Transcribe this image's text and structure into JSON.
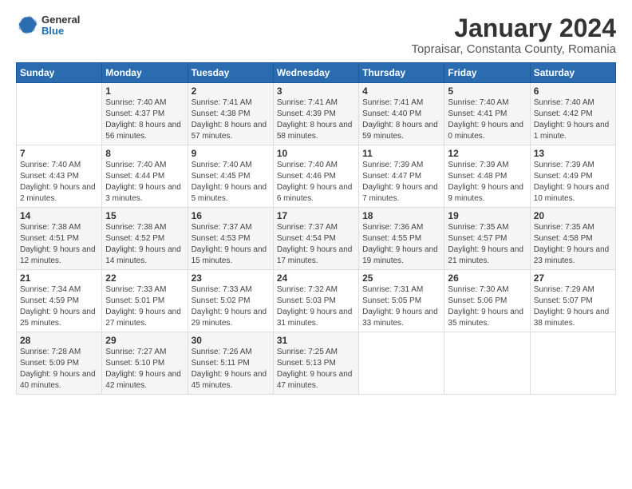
{
  "header": {
    "logo_general": "General",
    "logo_blue": "Blue",
    "title": "January 2024",
    "subtitle": "Topraisar, Constanta County, Romania"
  },
  "days_of_week": [
    "Sunday",
    "Monday",
    "Tuesday",
    "Wednesday",
    "Thursday",
    "Friday",
    "Saturday"
  ],
  "weeks": [
    [
      {
        "day": "",
        "sunrise": "",
        "sunset": "",
        "daylight": ""
      },
      {
        "day": "1",
        "sunrise": "Sunrise: 7:40 AM",
        "sunset": "Sunset: 4:37 PM",
        "daylight": "Daylight: 8 hours and 56 minutes."
      },
      {
        "day": "2",
        "sunrise": "Sunrise: 7:41 AM",
        "sunset": "Sunset: 4:38 PM",
        "daylight": "Daylight: 8 hours and 57 minutes."
      },
      {
        "day": "3",
        "sunrise": "Sunrise: 7:41 AM",
        "sunset": "Sunset: 4:39 PM",
        "daylight": "Daylight: 8 hours and 58 minutes."
      },
      {
        "day": "4",
        "sunrise": "Sunrise: 7:41 AM",
        "sunset": "Sunset: 4:40 PM",
        "daylight": "Daylight: 8 hours and 59 minutes."
      },
      {
        "day": "5",
        "sunrise": "Sunrise: 7:40 AM",
        "sunset": "Sunset: 4:41 PM",
        "daylight": "Daylight: 9 hours and 0 minutes."
      },
      {
        "day": "6",
        "sunrise": "Sunrise: 7:40 AM",
        "sunset": "Sunset: 4:42 PM",
        "daylight": "Daylight: 9 hours and 1 minute."
      }
    ],
    [
      {
        "day": "7",
        "sunrise": "Sunrise: 7:40 AM",
        "sunset": "Sunset: 4:43 PM",
        "daylight": "Daylight: 9 hours and 2 minutes."
      },
      {
        "day": "8",
        "sunrise": "Sunrise: 7:40 AM",
        "sunset": "Sunset: 4:44 PM",
        "daylight": "Daylight: 9 hours and 3 minutes."
      },
      {
        "day": "9",
        "sunrise": "Sunrise: 7:40 AM",
        "sunset": "Sunset: 4:45 PM",
        "daylight": "Daylight: 9 hours and 5 minutes."
      },
      {
        "day": "10",
        "sunrise": "Sunrise: 7:40 AM",
        "sunset": "Sunset: 4:46 PM",
        "daylight": "Daylight: 9 hours and 6 minutes."
      },
      {
        "day": "11",
        "sunrise": "Sunrise: 7:39 AM",
        "sunset": "Sunset: 4:47 PM",
        "daylight": "Daylight: 9 hours and 7 minutes."
      },
      {
        "day": "12",
        "sunrise": "Sunrise: 7:39 AM",
        "sunset": "Sunset: 4:48 PM",
        "daylight": "Daylight: 9 hours and 9 minutes."
      },
      {
        "day": "13",
        "sunrise": "Sunrise: 7:39 AM",
        "sunset": "Sunset: 4:49 PM",
        "daylight": "Daylight: 9 hours and 10 minutes."
      }
    ],
    [
      {
        "day": "14",
        "sunrise": "Sunrise: 7:38 AM",
        "sunset": "Sunset: 4:51 PM",
        "daylight": "Daylight: 9 hours and 12 minutes."
      },
      {
        "day": "15",
        "sunrise": "Sunrise: 7:38 AM",
        "sunset": "Sunset: 4:52 PM",
        "daylight": "Daylight: 9 hours and 14 minutes."
      },
      {
        "day": "16",
        "sunrise": "Sunrise: 7:37 AM",
        "sunset": "Sunset: 4:53 PM",
        "daylight": "Daylight: 9 hours and 15 minutes."
      },
      {
        "day": "17",
        "sunrise": "Sunrise: 7:37 AM",
        "sunset": "Sunset: 4:54 PM",
        "daylight": "Daylight: 9 hours and 17 minutes."
      },
      {
        "day": "18",
        "sunrise": "Sunrise: 7:36 AM",
        "sunset": "Sunset: 4:55 PM",
        "daylight": "Daylight: 9 hours and 19 minutes."
      },
      {
        "day": "19",
        "sunrise": "Sunrise: 7:35 AM",
        "sunset": "Sunset: 4:57 PM",
        "daylight": "Daylight: 9 hours and 21 minutes."
      },
      {
        "day": "20",
        "sunrise": "Sunrise: 7:35 AM",
        "sunset": "Sunset: 4:58 PM",
        "daylight": "Daylight: 9 hours and 23 minutes."
      }
    ],
    [
      {
        "day": "21",
        "sunrise": "Sunrise: 7:34 AM",
        "sunset": "Sunset: 4:59 PM",
        "daylight": "Daylight: 9 hours and 25 minutes."
      },
      {
        "day": "22",
        "sunrise": "Sunrise: 7:33 AM",
        "sunset": "Sunset: 5:01 PM",
        "daylight": "Daylight: 9 hours and 27 minutes."
      },
      {
        "day": "23",
        "sunrise": "Sunrise: 7:33 AM",
        "sunset": "Sunset: 5:02 PM",
        "daylight": "Daylight: 9 hours and 29 minutes."
      },
      {
        "day": "24",
        "sunrise": "Sunrise: 7:32 AM",
        "sunset": "Sunset: 5:03 PM",
        "daylight": "Daylight: 9 hours and 31 minutes."
      },
      {
        "day": "25",
        "sunrise": "Sunrise: 7:31 AM",
        "sunset": "Sunset: 5:05 PM",
        "daylight": "Daylight: 9 hours and 33 minutes."
      },
      {
        "day": "26",
        "sunrise": "Sunrise: 7:30 AM",
        "sunset": "Sunset: 5:06 PM",
        "daylight": "Daylight: 9 hours and 35 minutes."
      },
      {
        "day": "27",
        "sunrise": "Sunrise: 7:29 AM",
        "sunset": "Sunset: 5:07 PM",
        "daylight": "Daylight: 9 hours and 38 minutes."
      }
    ],
    [
      {
        "day": "28",
        "sunrise": "Sunrise: 7:28 AM",
        "sunset": "Sunset: 5:09 PM",
        "daylight": "Daylight: 9 hours and 40 minutes."
      },
      {
        "day": "29",
        "sunrise": "Sunrise: 7:27 AM",
        "sunset": "Sunset: 5:10 PM",
        "daylight": "Daylight: 9 hours and 42 minutes."
      },
      {
        "day": "30",
        "sunrise": "Sunrise: 7:26 AM",
        "sunset": "Sunset: 5:11 PM",
        "daylight": "Daylight: 9 hours and 45 minutes."
      },
      {
        "day": "31",
        "sunrise": "Sunrise: 7:25 AM",
        "sunset": "Sunset: 5:13 PM",
        "daylight": "Daylight: 9 hours and 47 minutes."
      },
      {
        "day": "",
        "sunrise": "",
        "sunset": "",
        "daylight": ""
      },
      {
        "day": "",
        "sunrise": "",
        "sunset": "",
        "daylight": ""
      },
      {
        "day": "",
        "sunrise": "",
        "sunset": "",
        "daylight": ""
      }
    ]
  ]
}
